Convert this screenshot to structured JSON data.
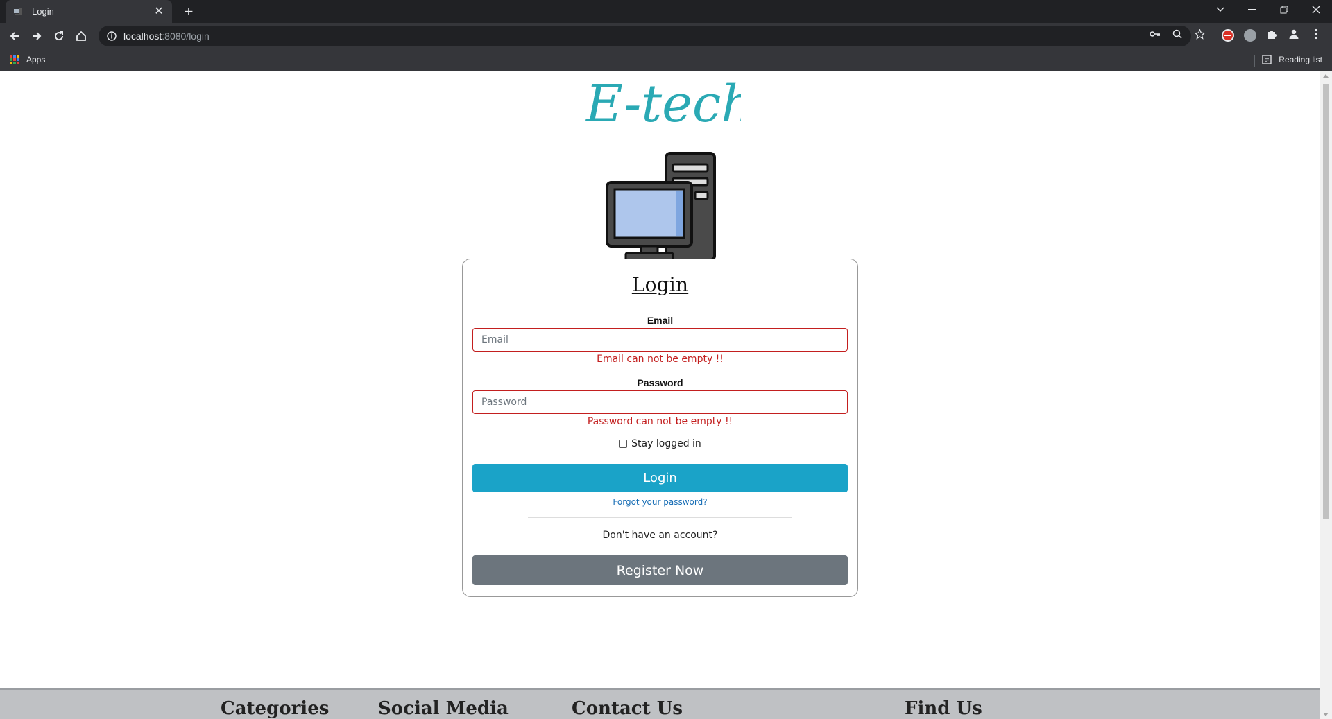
{
  "browser": {
    "tab_title": "Login",
    "url_host": "localhost",
    "url_path": ":8080/login",
    "bookmark_apps": "Apps",
    "reading_list": "Reading list"
  },
  "logo": {
    "text": "E-tech",
    "color": "#2aa9b4"
  },
  "login": {
    "title": "Login",
    "email_label": "Email",
    "email_placeholder": "Email",
    "email_value": "",
    "email_error": "Email can not be empty !!",
    "password_label": "Password",
    "password_placeholder": "Password",
    "password_value": "",
    "password_error": "Password can not be empty !!",
    "remember_label": "Stay logged in",
    "remember_checked": false,
    "login_button": "Login",
    "forgot_link": "Forgot your password?",
    "no_account": "Don't have an account?",
    "register_button": "Register Now"
  },
  "footer": {
    "columns": [
      "Categories",
      "Social Media",
      "Contact Us",
      "Find Us"
    ]
  },
  "colors": {
    "primary": "#1aa3c8",
    "secondary": "#6c757d",
    "error": "#c31f1f",
    "link": "#1a6fb6"
  }
}
